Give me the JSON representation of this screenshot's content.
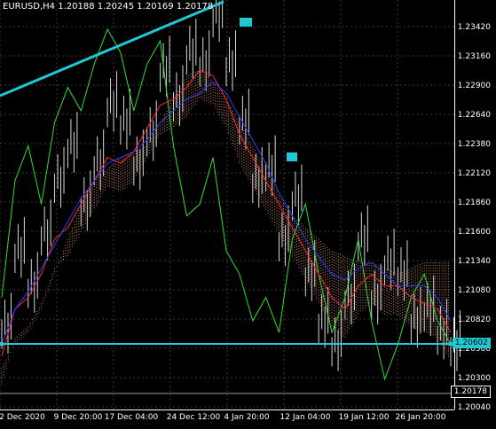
{
  "header": {
    "symbol_title": "EURUSD,H4",
    "bid_open": "1.20188",
    "bid_high": "1.20245",
    "bid_low": "1.20169",
    "bid_close": "1.20178"
  },
  "price_axis": {
    "labels": [
      "1.23420",
      "1.23160",
      "1.22900",
      "1.22640",
      "1.22380",
      "1.22120",
      "1.21860",
      "1.21600",
      "1.21340",
      "1.21080",
      "1.20820",
      "1.20560",
      "1.20300",
      "1.20040"
    ]
  },
  "time_axis": {
    "labels": [
      "2 Dec 2020",
      "9 Dec 20:00",
      "17 Dec 04:00",
      "24 Dec 12:00",
      "4 Jan 20:00",
      "12 Jan 04:00",
      "19 Jan 12:00",
      "26 Jan 20:00"
    ]
  },
  "markers": {
    "horizontal_line_price": "1.20602",
    "current_price": "1.20178"
  },
  "colors": {
    "background": "#000000",
    "grid": "#3a3a3a",
    "candles": "#d8d8d8",
    "trendline": "#1fc8d4",
    "hline": "#1fc8d4",
    "green_line": "#2ee02e",
    "red_line": "#ff2a2a",
    "blue_line": "#2a3cff",
    "cloud": "#f0a070"
  },
  "chart_data": {
    "type": "line",
    "title": "EURUSD,H4",
    "xlabel": "",
    "ylabel": "",
    "ylim": [
      1.2004,
      1.2355
    ],
    "grid": true,
    "x_ticks": [
      "2 Dec 2020",
      "9 Dec 20:00",
      "17 Dec 04:00",
      "24 Dec 12:00",
      "4 Jan 20:00",
      "12 Jan 04:00",
      "19 Jan 12:00",
      "26 Jan 20:00"
    ],
    "series": [
      {
        "color": "#d8d8d8",
        "values": [
          1.2075,
          1.214,
          1.211,
          1.2155,
          1.22,
          1.223,
          1.218,
          1.2215,
          1.2265,
          1.225,
          1.2215,
          1.224,
          1.2295,
          1.227,
          1.231,
          1.23,
          1.2342,
          1.23,
          1.225,
          1.22,
          1.221,
          1.215,
          1.2185,
          1.212,
          1.208,
          1.206,
          1.21,
          1.215,
          1.21,
          1.213,
          1.212,
          1.208,
          1.209,
          1.207,
          1.206
        ]
      },
      {
        "color": "#2ee02e",
        "values": [
          1.21,
          1.22,
          1.223,
          1.218,
          1.225,
          1.228,
          1.226,
          1.23,
          1.233,
          1.231,
          1.226,
          1.23,
          1.232,
          1.223,
          1.217,
          1.218,
          1.222,
          1.214,
          1.212,
          1.208,
          1.21,
          1.207,
          1.215,
          1.218,
          1.212,
          1.207,
          1.21,
          1.215,
          1.208,
          1.203,
          1.206,
          1.21,
          1.212,
          1.208,
          1.206
        ]
      },
      {
        "color": "#ff2a2a",
        "values": [
          1.205,
          1.209,
          1.21,
          1.212,
          1.215,
          1.216,
          1.218,
          1.22,
          1.222,
          1.2215,
          1.2225,
          1.2245,
          1.2265,
          1.227,
          1.228,
          1.2295,
          1.229,
          1.227,
          1.224,
          1.222,
          1.22,
          1.218,
          1.216,
          1.214,
          1.212,
          1.21,
          1.209,
          1.211,
          1.212,
          1.211,
          1.211,
          1.21,
          1.2095,
          1.209,
          1.207
        ]
      },
      {
        "color": "#2a3cff",
        "values": [
          1.206,
          1.209,
          1.2105,
          1.2125,
          1.2145,
          1.2165,
          1.2185,
          1.22,
          1.2215,
          1.222,
          1.2225,
          1.2235,
          1.225,
          1.226,
          1.227,
          1.2275,
          1.2285,
          1.2275,
          1.2255,
          1.2235,
          1.2215,
          1.219,
          1.217,
          1.215,
          1.2135,
          1.212,
          1.2115,
          1.2125,
          1.213,
          1.212,
          1.211,
          1.211,
          1.211,
          1.21,
          1.208
        ]
      },
      {
        "color": "#f0a070",
        "values": [
          1.204,
          1.206,
          1.207,
          1.209,
          1.212,
          1.215,
          1.218,
          1.22,
          1.221,
          1.222,
          1.2225,
          1.223,
          1.225,
          1.227,
          1.229,
          1.2295,
          1.2285,
          1.227,
          1.225,
          1.223,
          1.221,
          1.219,
          1.217,
          1.216,
          1.215,
          1.214,
          1.2135,
          1.213,
          1.213,
          1.2125,
          1.212,
          1.2125,
          1.213,
          1.213,
          1.213
        ]
      }
    ],
    "horizontal_line": 1.20602,
    "current_price": 1.20178
  }
}
